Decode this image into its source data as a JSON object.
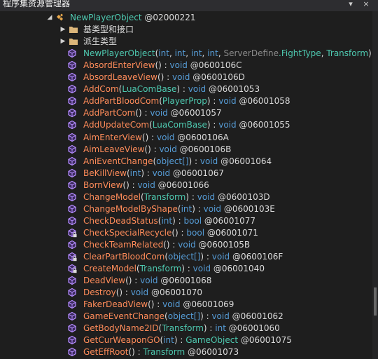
{
  "window": {
    "title": "程序集资源管理器",
    "pin_glyph": "▾",
    "close_glyph": "×"
  },
  "colors": {
    "background": "#1e1e1e",
    "method_name": "#ff8c5a",
    "type_name": "#4ec9b0",
    "keyword": "#569cd6",
    "token": "#8a8a8a",
    "method_icon": "#b58cff"
  },
  "tree": {
    "class_node": {
      "name": "NewPlayerObject",
      "token": "@02000221",
      "icon": "class-icon",
      "expanded": true
    },
    "folders": [
      {
        "label": "基类型和接口",
        "icon": "folder-icon"
      },
      {
        "label": "派生类型",
        "icon": "folder-icon"
      }
    ],
    "constructor": {
      "name": "NewPlayerObject",
      "open": "(",
      "params": [
        {
          "type": "int",
          "kind": "keyword"
        },
        {
          "type": "int",
          "kind": "keyword"
        },
        {
          "type": "int",
          "kind": "keyword"
        },
        {
          "type": "int",
          "kind": "keyword"
        },
        {
          "type": "ServerDefine",
          "kind": "gray"
        },
        {
          "type": ".FightType",
          "kind": "type",
          "no_sep": true
        },
        {
          "type": "Transform",
          "kind": "type"
        }
      ],
      "close": ")",
      "colon": ":",
      "ret": "vo"
    },
    "methods": [
      {
        "name": "AbsordEnterView",
        "params": "",
        "ret": "void",
        "ret_kind": "keyword",
        "token": "@0600106C",
        "icon": "method-icon"
      },
      {
        "name": "AbsordLeaveView",
        "params": "",
        "ret": "void",
        "ret_kind": "keyword",
        "token": "@0600106D",
        "icon": "method-icon"
      },
      {
        "name": "AddCom",
        "params": "LuaComBase",
        "param_kind": "type",
        "ret": "void",
        "ret_kind": "keyword",
        "token": "@06001053",
        "icon": "method-icon"
      },
      {
        "name": "AddPartBloodCom",
        "params": "PlayerProp",
        "param_kind": "type",
        "ret": "void",
        "ret_kind": "keyword",
        "token": "@06001058",
        "icon": "method-icon"
      },
      {
        "name": "AddPartCom",
        "params": "",
        "ret": "void",
        "ret_kind": "keyword",
        "token": "@06001057",
        "icon": "method-icon"
      },
      {
        "name": "AddUpdateCom",
        "params": "LuaComBase",
        "param_kind": "type",
        "ret": "void",
        "ret_kind": "keyword",
        "token": "@06001055",
        "icon": "method-icon"
      },
      {
        "name": "AimEnterView",
        "params": "",
        "ret": "void",
        "ret_kind": "keyword",
        "token": "@0600106A",
        "icon": "method-icon"
      },
      {
        "name": "AimLeaveView",
        "params": "",
        "ret": "void",
        "ret_kind": "keyword",
        "token": "@0600106B",
        "icon": "method-icon"
      },
      {
        "name": "AniEventChange",
        "params": "object[]",
        "param_kind": "keyword",
        "ret": "void",
        "ret_kind": "keyword",
        "token": "@06001064",
        "icon": "method-icon"
      },
      {
        "name": "BeKillView",
        "params": "int",
        "param_kind": "keyword",
        "ret": "void",
        "ret_kind": "keyword",
        "token": "@06001067",
        "icon": "method-icon"
      },
      {
        "name": "BornView",
        "params": "",
        "ret": "void",
        "ret_kind": "keyword",
        "token": "@06001066",
        "icon": "method-icon"
      },
      {
        "name": "ChangeModel",
        "params": "Transform",
        "param_kind": "type",
        "ret": "void",
        "ret_kind": "keyword",
        "token": "@0600103D",
        "icon": "method-icon"
      },
      {
        "name": "ChangeModelByShape",
        "params": "int",
        "param_kind": "keyword",
        "ret": "void",
        "ret_kind": "keyword",
        "token": "@0600103E",
        "icon": "method-icon"
      },
      {
        "name": "CheckDeadStatus",
        "params": "int",
        "param_kind": "keyword",
        "ret": "bool",
        "ret_kind": "keyword",
        "token": "@06001077",
        "icon": "method-icon"
      },
      {
        "name": "CheckSpecialRecycle",
        "params": "",
        "ret": "bool",
        "ret_kind": "keyword",
        "token": "@06001071",
        "icon": "private-method-icon"
      },
      {
        "name": "CheckTeamRelated",
        "params": "",
        "ret": "void",
        "ret_kind": "keyword",
        "token": "@0600105B",
        "icon": "method-icon"
      },
      {
        "name": "ClearPartBloodCom",
        "params": "object[]",
        "param_kind": "keyword",
        "ret": "void",
        "ret_kind": "keyword",
        "token": "@0600106F",
        "icon": "private-method-icon"
      },
      {
        "name": "CreateModel",
        "params": "Transform",
        "param_kind": "type",
        "ret": "void",
        "ret_kind": "keyword",
        "token": "@06001040",
        "icon": "private-method-icon"
      },
      {
        "name": "DeadView",
        "params": "",
        "ret": "void",
        "ret_kind": "keyword",
        "token": "@06001068",
        "icon": "method-icon"
      },
      {
        "name": "Destroy",
        "params": "",
        "ret": "void",
        "ret_kind": "keyword",
        "token": "@06001070",
        "icon": "method-icon"
      },
      {
        "name": "FakerDeadView",
        "params": "",
        "ret": "void",
        "ret_kind": "keyword",
        "token": "@06001069",
        "icon": "method-icon"
      },
      {
        "name": "GameEventChange",
        "params": "object[]",
        "param_kind": "keyword",
        "ret": "void",
        "ret_kind": "keyword",
        "token": "@06001062",
        "icon": "method-icon"
      },
      {
        "name": "GetBodyName2ID",
        "params": "Transform",
        "param_kind": "type",
        "ret": "int",
        "ret_kind": "keyword",
        "token": "@06001060",
        "icon": "method-icon"
      },
      {
        "name": "GetCurWeaponGO",
        "params": "int",
        "param_kind": "keyword",
        "ret": "GameObject",
        "ret_kind": "type",
        "token": "@06001075",
        "icon": "method-icon"
      },
      {
        "name": "GetEffRoot",
        "params": "",
        "ret": "Transform",
        "ret_kind": "type",
        "token": "@06001073",
        "icon": "method-icon"
      }
    ]
  }
}
